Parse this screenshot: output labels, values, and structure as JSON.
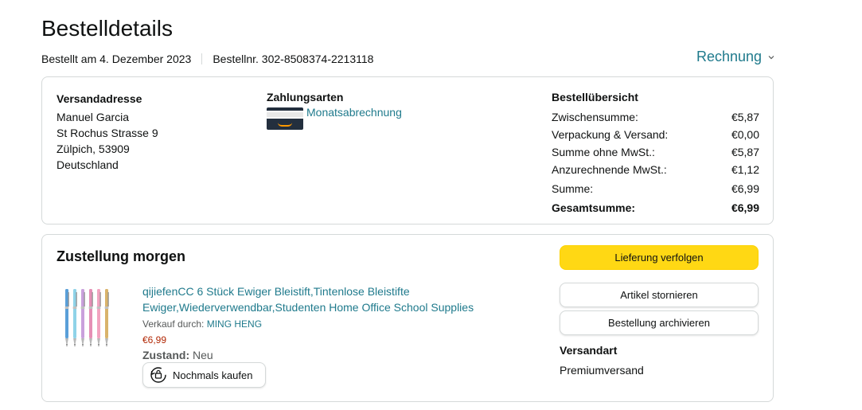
{
  "page": {
    "title": "Bestelldetails",
    "ordered_on": "Bestellt am 4. Dezember 2023",
    "order_number": "Bestellnr. 302-8508374-2213118",
    "invoice_label": "Rechnung"
  },
  "shipping_address": {
    "heading": "Versandadresse",
    "lines": [
      "Manuel Garcia",
      "St Rochus Strasse 9",
      "Zülpich, 53909",
      "Deutschland"
    ]
  },
  "payment": {
    "heading": "Zahlungsarten",
    "method": "Monatsabrechnung",
    "icon": "amazon-card-icon"
  },
  "summary": {
    "heading": "Bestellübersicht",
    "rows": [
      {
        "label": "Zwischensumme:",
        "value": "€5,87"
      },
      {
        "label": "Verpackung & Versand:",
        "value": "€0,00"
      },
      {
        "label": "Summe ohne MwSt.:",
        "value": "€5,87"
      },
      {
        "label": "Anzurechnende MwSt.:",
        "value": "€1,12"
      },
      {
        "label": "Summe:",
        "value": "€6,99"
      }
    ],
    "total_label": "Gesamtsumme:",
    "total_value": "€6,99"
  },
  "delivery": {
    "heading": "Zustellung morgen",
    "product": {
      "title": "qijiefenCC 6 Stück Ewiger Bleistift,Tintenlose Bleistifte Ewiger,Wiederverwendbar,Studenten Home Office School Supplies",
      "seller_prefix": "Verkauf durch: ",
      "seller_name": "MING HENG",
      "price": "€6,99",
      "condition_label": "Zustand:",
      "condition_value": "Neu",
      "rebuy_label": "Nochmals kaufen",
      "pencil_colors": [
        "#5a9fd8",
        "#8fd3e8",
        "#c9a0dc",
        "#e58fb5",
        "#f2a3c0",
        "#d9b36b"
      ]
    },
    "buttons": {
      "track": "Lieferung verfolgen",
      "cancel": "Artikel stornieren",
      "archive": "Bestellung archivieren"
    },
    "shipping_type_heading": "Versandart",
    "shipping_type": "Premiumversand"
  },
  "colors": {
    "link": "#1f7a8c",
    "price": "#b12704",
    "track_button": "#ffd814",
    "border": "#d5d9d9"
  }
}
